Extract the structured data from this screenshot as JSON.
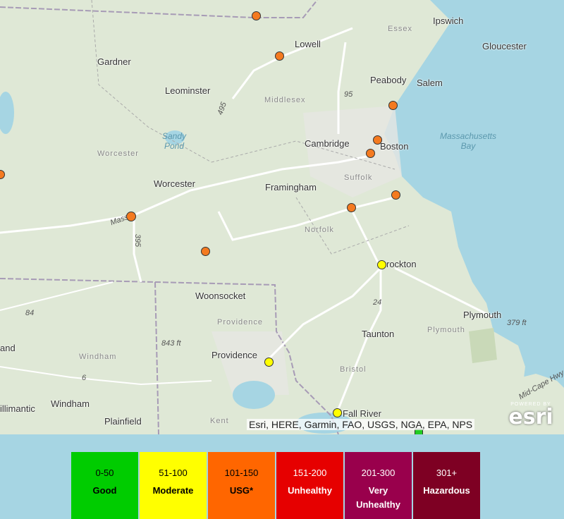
{
  "map": {
    "labels": {
      "ipswich": "Ipswich",
      "essex": "Essex",
      "lowell": "Lowell",
      "gloucester": "Gloucester",
      "gardner": "Gardner",
      "peabody": "Peabody",
      "salem": "Salem",
      "leominster": "Leominster",
      "middlesex": "Middlesex",
      "route95": "95",
      "sandy_pond": "Sandy\nPond",
      "massachusetts_bay": "Massachusetts\nBay",
      "cambridge": "Cambridge",
      "boston": "Boston",
      "worcester_county": "Worcester",
      "worcester": "Worcester",
      "suffolk": "Suffolk",
      "framingham": "Framingham",
      "massachusetts_road": "Massa",
      "route495": "495",
      "route395": "395",
      "norfolk": "Norfolk",
      "brockton": "rockton",
      "woonsocket": "Woonsocket",
      "route84": "84",
      "route24": "24",
      "plymouth": "Plymouth",
      "plymouth_county": "Plymouth",
      "depth_379": "379 ft",
      "providence_county": "Providence",
      "taunton": "Taunton",
      "land": "and",
      "elevation_843": "843 ft",
      "windham_county": "Windham",
      "providence": "Providence",
      "bristol": "Bristol",
      "route6": "6",
      "mid_cape_hwy": "Mid-Cape Hwy",
      "illimantic": "illimantic",
      "windham": "Windham",
      "fall_river": "Fall River",
      "plainfield": "Plainfield",
      "kent": "Kent"
    },
    "stations": [
      {
        "color": "#f47a20"
      },
      {
        "color": "#f47a20"
      },
      {
        "color": "#f47a20"
      },
      {
        "color": "#f47a20"
      },
      {
        "color": "#f47a20"
      },
      {
        "color": "#f47a20"
      },
      {
        "color": "#f47a20"
      },
      {
        "color": "#f47a20"
      },
      {
        "color": "#f47a20"
      },
      {
        "color": "#f47a20"
      },
      {
        "color": "#ffff00"
      },
      {
        "color": "#ffff00"
      },
      {
        "color": "#ffff00"
      },
      {
        "color": "#22cc22"
      }
    ],
    "attribution": "Esri, HERE, Garmin, FAO, USGS, NGA, EPA, NPS",
    "logo": {
      "powered": "POWERED BY",
      "name": "esri"
    }
  },
  "legend": [
    {
      "range": "0-50",
      "category": "Good",
      "color": "#00cc00",
      "text_color": "#000000"
    },
    {
      "range": "51-100",
      "category": "Moderate",
      "color": "#ffff00",
      "text_color": "#000000"
    },
    {
      "range": "101-150",
      "category": "USG*",
      "color": "#ff6600",
      "text_color": "#000000"
    },
    {
      "range": "151-200",
      "category": "Unhealthy",
      "color": "#e60000",
      "text_color": "#ffffff"
    },
    {
      "range": "201-300",
      "category": "Very\nUnhealthy",
      "color": "#99004c",
      "text_color": "#ffffff"
    },
    {
      "range": "301+",
      "category": "Hazardous",
      "color": "#7e0023",
      "text_color": "#ffffff"
    }
  ]
}
